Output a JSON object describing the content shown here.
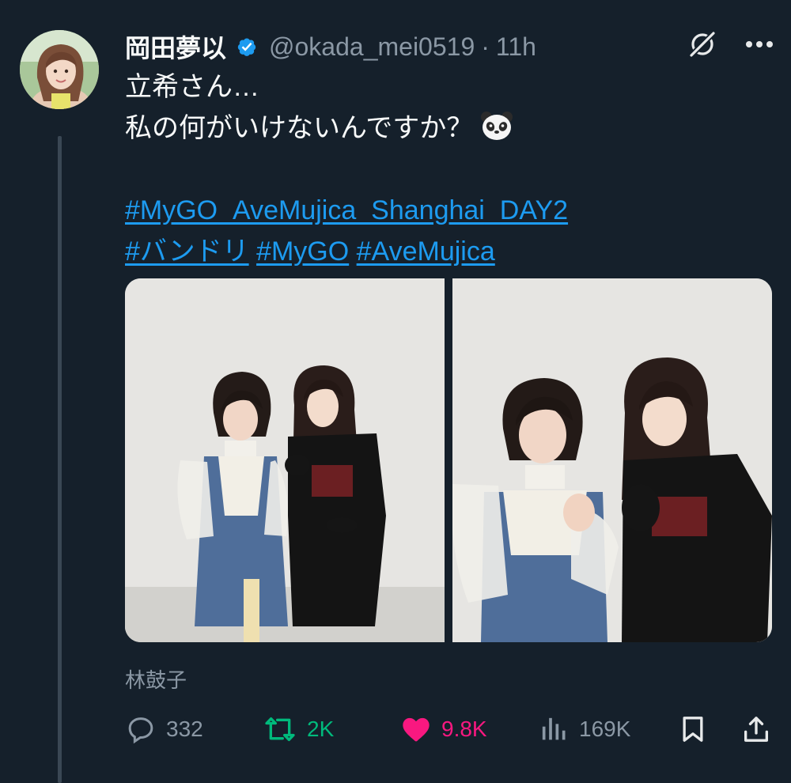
{
  "tweet": {
    "author": {
      "display_name": "岡田夢以",
      "handle": "@okada_mei0519",
      "separator": "·",
      "time": "11h",
      "verified": true
    },
    "text_lines": [
      "立希さん…",
      "私の何がいけないんですか？"
    ],
    "emoji": "panda-face",
    "hashtags_line1": [
      "#MyGO_AveMujica_Shanghai_DAY2"
    ],
    "hashtags_line2": [
      "#バンドリ",
      "#MyGO",
      "#AveMujica"
    ],
    "media_caption": "林鼓子",
    "metrics": {
      "replies": "332",
      "reposts": "2K",
      "likes": "9.8K",
      "views": "169K"
    },
    "liked": true
  },
  "colors": {
    "background": "#15202b",
    "text": "#f7f9f9",
    "muted": "#8b98a5",
    "link": "#1d9bf0",
    "repost": "#00ba7c",
    "like": "#f91880",
    "verified": "#1d9bf0"
  }
}
